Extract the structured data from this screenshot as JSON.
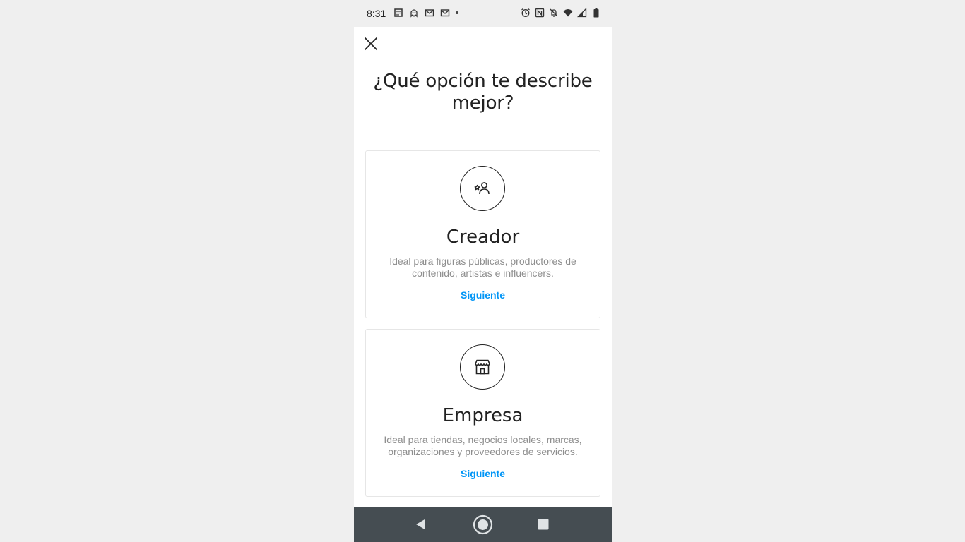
{
  "status_bar": {
    "time": "8:31",
    "left_icons": [
      "news-icon",
      "ghost-notification-icon",
      "gmail-icon",
      "gmail-icon",
      "more-dot-icon"
    ],
    "right_icons": [
      "alarm-icon",
      "nfc-icon",
      "mute-icon",
      "wifi-icon",
      "signal-icon",
      "battery-icon"
    ]
  },
  "header": {
    "close_icon": "close-icon",
    "title": "¿Qué opción te describe mejor?"
  },
  "options": [
    {
      "icon": "creator-star-person-icon",
      "title": "Creador",
      "description": "Ideal para figuras públicas, productores de contenido, artistas e influencers.",
      "link": "Siguiente"
    },
    {
      "icon": "storefront-icon",
      "title": "Empresa",
      "description": "Ideal para tiendas, negocios locales, marcas, organizaciones y proveedores de servicios.",
      "link": "Siguiente"
    }
  ],
  "navigation": {
    "back_icon": "back-triangle-icon",
    "home_icon": "home-circle-icon",
    "recents_icon": "recents-square-icon"
  },
  "colors": {
    "link": "#0095f6",
    "text": "#222222",
    "secondary_text": "#8e8e8e",
    "nav_bar": "#454d52",
    "background": "#efefef"
  }
}
